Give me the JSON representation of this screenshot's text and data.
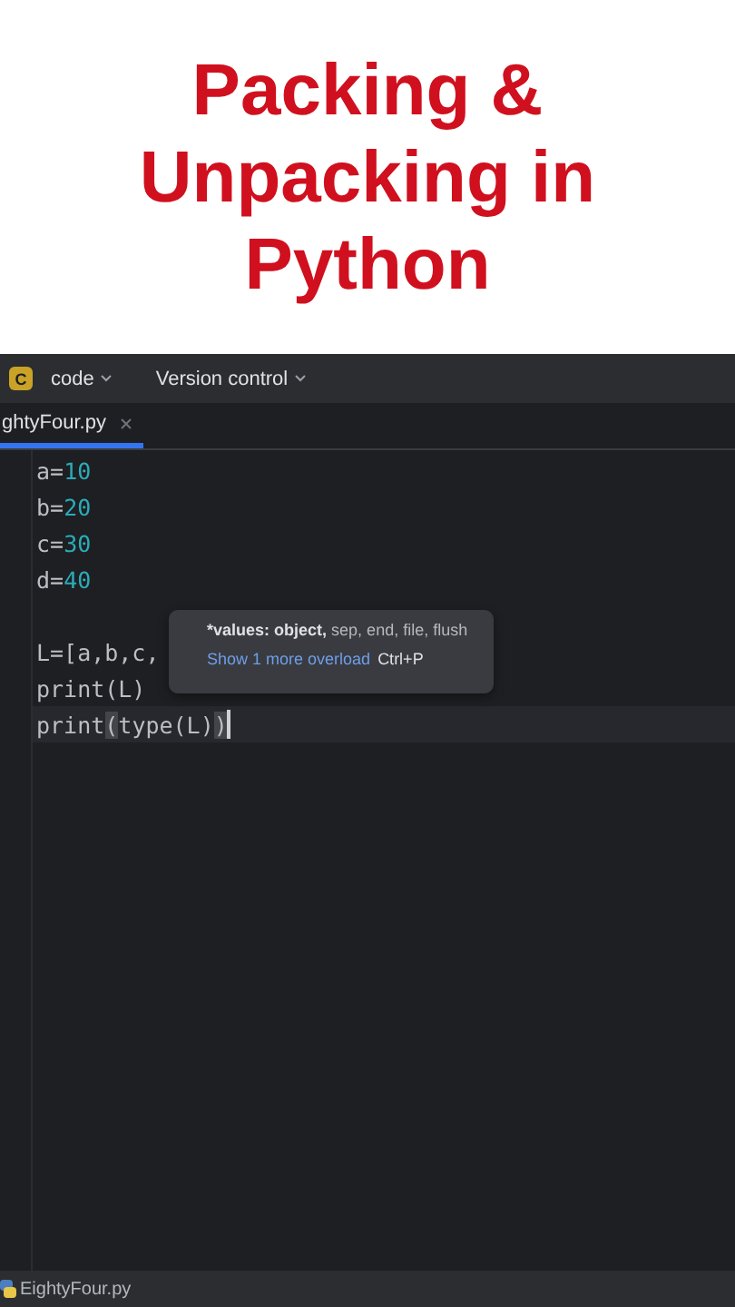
{
  "headline": [
    "Packing &",
    "Unpacking in",
    "Python"
  ],
  "toolbar": {
    "project_initial": "C",
    "project": "code",
    "vcs": "Version control"
  },
  "tabs": [
    {
      "label": "ghtyFour.py",
      "selected": true
    }
  ],
  "editor": {
    "lines": [
      {
        "current": false,
        "tokens": [
          {
            "kind": "plain",
            "text": "a="
          },
          {
            "kind": "number",
            "text": "10"
          }
        ]
      },
      {
        "current": false,
        "tokens": [
          {
            "kind": "plain",
            "text": "b="
          },
          {
            "kind": "number",
            "text": "20"
          }
        ]
      },
      {
        "current": false,
        "tokens": [
          {
            "kind": "plain",
            "text": "c="
          },
          {
            "kind": "number",
            "text": "30"
          }
        ]
      },
      {
        "current": false,
        "tokens": [
          {
            "kind": "plain",
            "text": "d="
          },
          {
            "kind": "number",
            "text": "40"
          }
        ]
      },
      {
        "current": false
      },
      {
        "current": false,
        "tokens": [
          {
            "kind": "plain",
            "text": "L=[a,b,c,"
          }
        ]
      },
      {
        "current": false,
        "tokens": [
          {
            "kind": "plain",
            "text": "print(L)"
          }
        ]
      },
      {
        "current": true,
        "tokens": [
          {
            "kind": "plain",
            "text": "print"
          },
          {
            "kind": "match",
            "text": "("
          },
          {
            "kind": "plain",
            "text": "type(L)"
          },
          {
            "kind": "match",
            "text": ")"
          }
        ]
      }
    ]
  },
  "tooltip": {
    "signature_bold": "*values: object,",
    "signature_rest": "sep, end, file, flush",
    "link": "Show 1 more overload",
    "shortcut": "Ctrl+P"
  },
  "status_bar": {
    "file": "EightyFour.py"
  }
}
